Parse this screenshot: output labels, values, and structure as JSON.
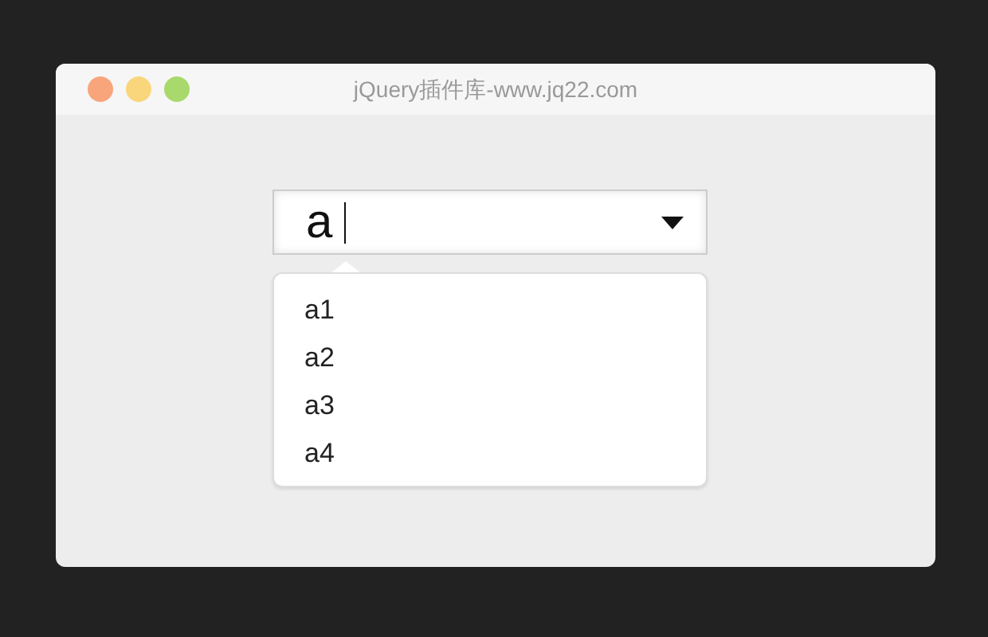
{
  "window": {
    "title": "jQuery插件库-www.jq22.com"
  },
  "combobox": {
    "value": "a",
    "expanded": true
  },
  "options": [
    {
      "label": "a1"
    },
    {
      "label": "a2"
    },
    {
      "label": "a3"
    },
    {
      "label": "a4"
    }
  ]
}
